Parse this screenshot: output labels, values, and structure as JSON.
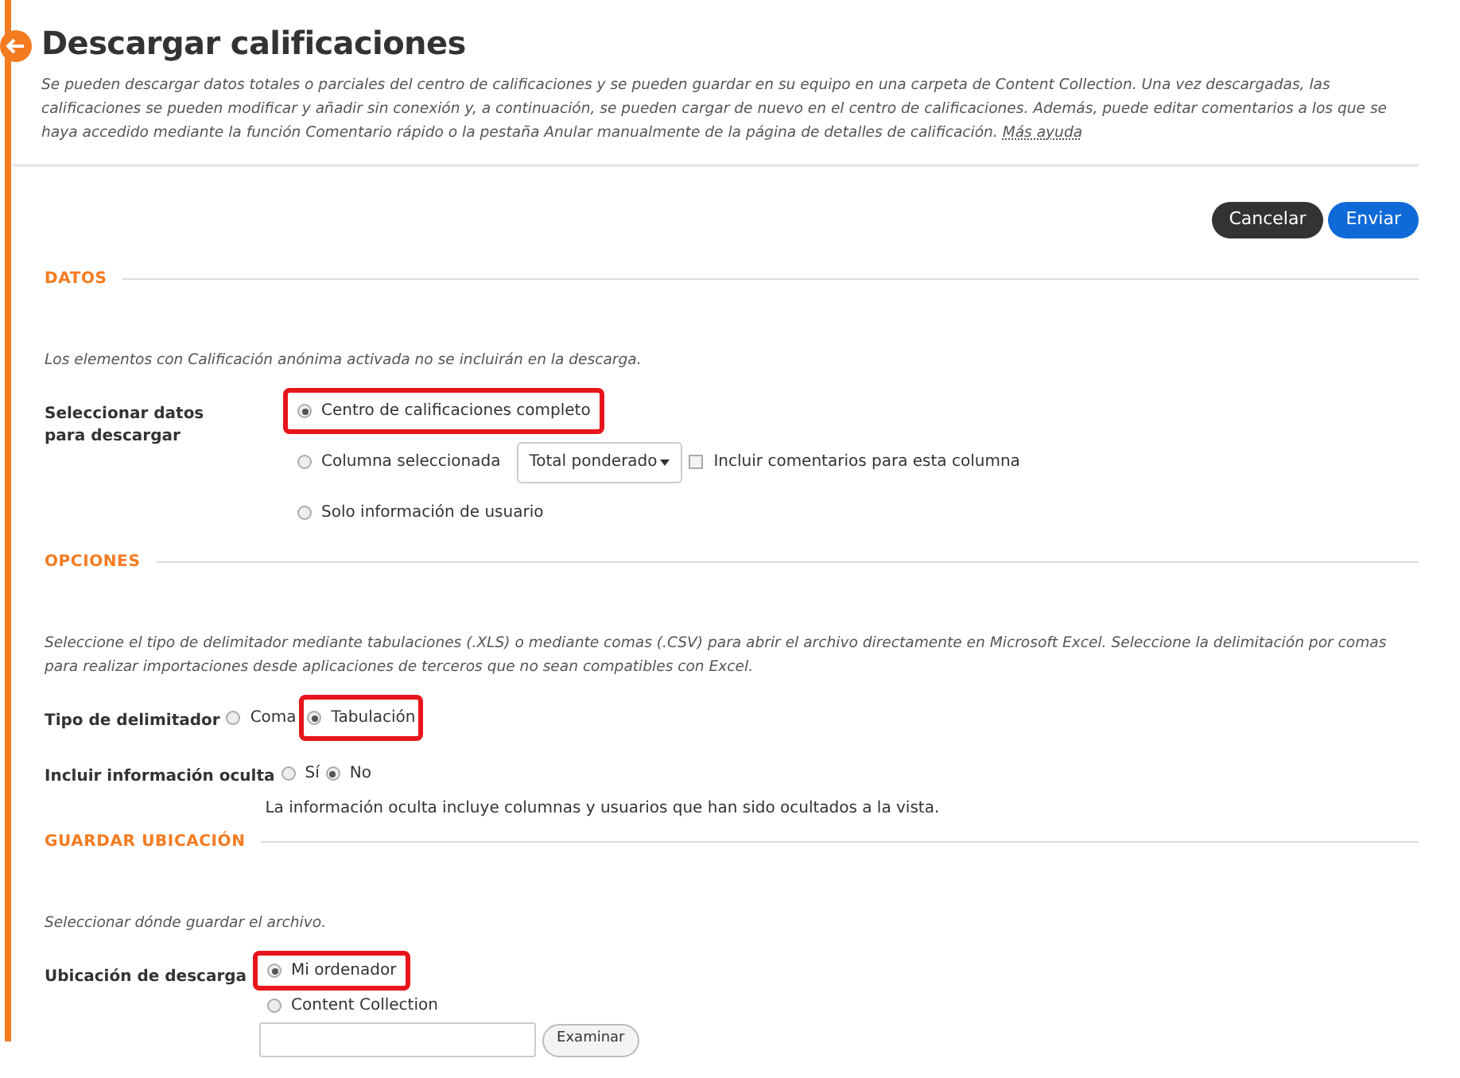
{
  "page": {
    "title": "Descargar calificaciones",
    "description": "Se pueden descargar datos totales o parciales del centro de calificaciones y se pueden guardar en su equipo en una carpeta de Content Collection. Una vez descargadas, las calificaciones se pueden modificar y añadir sin conexión y, a continuación, se pueden cargar de nuevo en el centro de calificaciones. Además, puede editar comentarios a los que se haya accedido mediante la función Comentario rápido o la pestaña Anular manualmente de la página de detalles de calificación.",
    "help_link": "Más ayuda"
  },
  "buttons": [
    {
      "label": "Cancelar",
      "kind": "secondary"
    },
    {
      "label": "Enviar",
      "kind": "primary"
    }
  ],
  "sections": [
    {
      "heading": "DATOS",
      "note": "Los elementos con Calificación anónima activada no se incluirán en la descarga.",
      "fields": [
        {
          "kind": "radio-stack",
          "label": "Seleccionar datos para descargar",
          "options": [
            {
              "label": "Centro de calificaciones completo",
              "selected": true,
              "highlighted": true
            },
            {
              "label": "Columna seleccionada",
              "selected": false,
              "highlighted": false,
              "dropdown": "Total ponderado",
              "checkbox": {
                "label": "Incluir comentarios para esta columna",
                "checked": false
              }
            },
            {
              "label": "Solo información de usuario",
              "selected": false,
              "highlighted": false
            }
          ]
        }
      ]
    },
    {
      "heading": "OPCIONES",
      "note": "Seleccione el tipo de delimitador mediante tabulaciones (.XLS) o mediante comas (.CSV) para abrir el archivo directamente en Microsoft Excel. Seleccione la delimitación por comas para realizar importaciones desde aplicaciones de terceros que no sean compatibles con Excel.",
      "fields": [
        {
          "kind": "radio-inline",
          "label": "Tipo de delimitador",
          "options": [
            {
              "label": "Coma",
              "selected": false,
              "highlighted": false
            },
            {
              "label": "Tabulación",
              "selected": true,
              "highlighted": true
            }
          ]
        },
        {
          "kind": "radio-inline",
          "label": "Incluir información oculta",
          "options": [
            {
              "label": "Sí",
              "selected": false,
              "highlighted": false
            },
            {
              "label": "No",
              "selected": true,
              "highlighted": false
            }
          ],
          "help": "La información oculta incluye columnas y usuarios que han sido ocultados a la vista."
        }
      ]
    },
    {
      "heading": "GUARDAR UBICACIÓN",
      "note": "Seleccionar dónde guardar el archivo.",
      "fields": [
        {
          "kind": "location",
          "label": "Ubicación de descarga",
          "options": [
            {
              "label": "Mi ordenador",
              "selected": true,
              "highlighted": true
            },
            {
              "label": "Content Collection",
              "selected": false,
              "highlighted": false
            }
          ],
          "browse_button": "Examinar"
        }
      ]
    }
  ]
}
